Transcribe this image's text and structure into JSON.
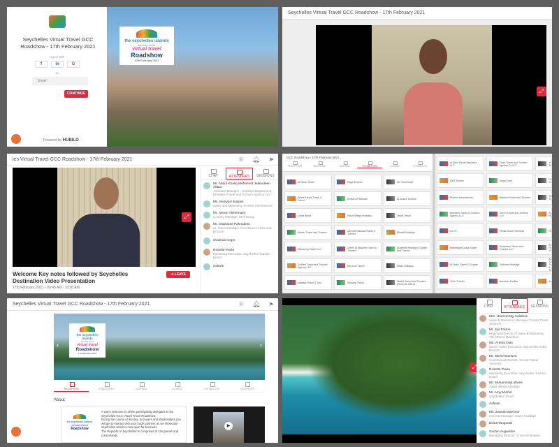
{
  "event_title": "Seychelles Virtual Travel GCC Roadshow - 17th February 2021",
  "p3_title": "les Virtual Travel GCC Roadshow - 17th February 2021",
  "p4_title": "GCC Roadshow - 17th February 2021",
  "login": {
    "title": "Seychelles Virtual Travel GCC Roadshow - 17th February 2021",
    "login_with": "Log in with",
    "social": [
      "f",
      "in",
      "G"
    ],
    "or": "or",
    "email_placeholder": "Email",
    "continue": "CONTINUE",
    "powered_by": "Powered by",
    "brand": "HUBILO"
  },
  "logo": {
    "line1": "the seychelles islands",
    "line2": "another world",
    "line3": "virtual travel",
    "line4": "Roadshow",
    "line5": "17th February 2021"
  },
  "keynote": {
    "title": "Welcome Key notes followed by Seychelles Destination Video Presentation",
    "datetime": "17th February, 2021 • 09:45 AM - 10:00 AM",
    "leave": "LEAVE",
    "tabs": [
      "CHAT",
      "ATTENDEES",
      "SESSIONS"
    ],
    "attendees": [
      {
        "name": "Mr. Abdul Khaliq Mohamed Jalaludeen Akbar",
        "role": "Assistant Manager - Holidays Department, Emirates Travel and Tourism Agency LLC"
      },
      {
        "name": "Ms. Mariyam Kapasi",
        "role": "Sales and Marketing, Pristine International"
      },
      {
        "name": "Mr. Akram Alshemaey",
        "role": "Country Manager, SKT Group"
      },
      {
        "name": "Mr. Shaharas Pakrudeen",
        "role": "Sr. Sales Manager, Constance Hotels and Resorts"
      },
      {
        "name": "shaimaa negm",
        "role": ""
      },
      {
        "name": "Rosette Pavia",
        "role": "Marketing Executive, Seychelles Tourism Board"
      },
      {
        "name": "Ashwin",
        "role": ""
      }
    ]
  },
  "exhibitors": {
    "nav": [
      "RECEPTION",
      "SESSIONS",
      "AGENDA",
      "EXHIBITORS",
      "LOUNGE",
      "SPONSORS"
    ],
    "left": [
      "Al Yousr Travel",
      "Raya Tourism",
      "Mr. Travelmart",
      "White Sands Travel & Travel",
      "Emaar Al Harmain",
      "Al Azaba Tourism",
      "Lama World",
      "Saudi Wings Holidays",
      "Jewel Travel",
      "Alforth Travel and Tourism",
      "Citi International Travel & Tourism",
      "Benefit Holidays",
      "Discovery Travel LLC",
      "Green Al Masafer Travel & Tourism",
      "Alzamma Holidays Tourism and Travels",
      "Golden Travel and Tourism Agency LLC",
      "Sky Line Travel",
      "Elfaid Holidays",
      "Jawlaat Travel & Tour",
      "Security Travel",
      "Jawlat Travel and Tourism (Reverse Office)"
    ],
    "right": [
      "Al Baro Travel Agencies LLC",
      "Omni Travel and Tourism Agency Co LLC",
      "Yalla Tours",
      "DNT Travels",
      "Sawa Tours",
      "Dallah Travel",
      "Pristine International",
      "Wisdom Travel and Tourism",
      "Sikkak Travel",
      "Emirates Travel & Tourism Agency LLC",
      "Green Travel and Tourism LLC",
      "Al Faraa",
      "KCTC",
      "Emilia Travel Services",
      "Rasta",
      "Manhattan Dubai Travel",
      "Hinterland Travel and Tourism LLC",
      "Al Rashid Travel",
      "Al Naka Travel & Tourism",
      "Gallivant Holidays",
      "Al Sakkak Travel & Tourism",
      "ToDo Travels",
      "Business Hotline",
      "Amex"
    ]
  },
  "reception": {
    "tabs": [
      "RECEPTION",
      "EVENT FEED",
      "AGENDA",
      "LOUNGE",
      "EXHIBITORS",
      "SPONSORS"
    ],
    "about": "About",
    "p1": "A warm welcome to all the participating delegates to the Seychelles GCC Virtual Travel Roadshow.",
    "p2": "During the course of the day, as buyers and stakeholders you will get to interact with your trade partners as we showcase Seychelles which is now open for business.",
    "p3": "The Republic of Seychelles is comprised of 115 granite and coral islands"
  },
  "aerial": {
    "tabs": [
      "CHAT",
      "ATTENDEES",
      "SESSIONS"
    ],
    "attendees": [
      {
        "name": "Mrs. Harrimendy Salabion",
        "role": "Sales & Marketing Manager, Creole Travel Services"
      },
      {
        "name": "Mr. Jijo Frame",
        "role": "Regional Director of Sales & Marketing, The Oberoi Mauritius"
      },
      {
        "name": "Ms. Aretha Dias",
        "role": "Senior Sales Executive, Seychelles Indeo Resorts"
      },
      {
        "name": "Mr. Michel Doriven",
        "role": "Commercial Director, Creole Travel Services"
      },
      {
        "name": "Rosette Pavia",
        "role": "Marketing Executive, Seychelles Tourism Board"
      },
      {
        "name": "Mr. Muhammad idrees",
        "role": "Saudi Wings Holidays"
      },
      {
        "name": "Mr. Amy Michel",
        "role": "Seychelles Travel"
      },
      {
        "name": "Ashwin",
        "role": ""
      },
      {
        "name": "Ms. Zainab Mansoor",
        "role": "General Manager, Sawa Holidays"
      },
      {
        "name": "Belal Rangnawi",
        "role": ""
      },
      {
        "name": "Sachin Augustine",
        "role": "Managing Director, Cross Worldwide"
      }
    ]
  }
}
